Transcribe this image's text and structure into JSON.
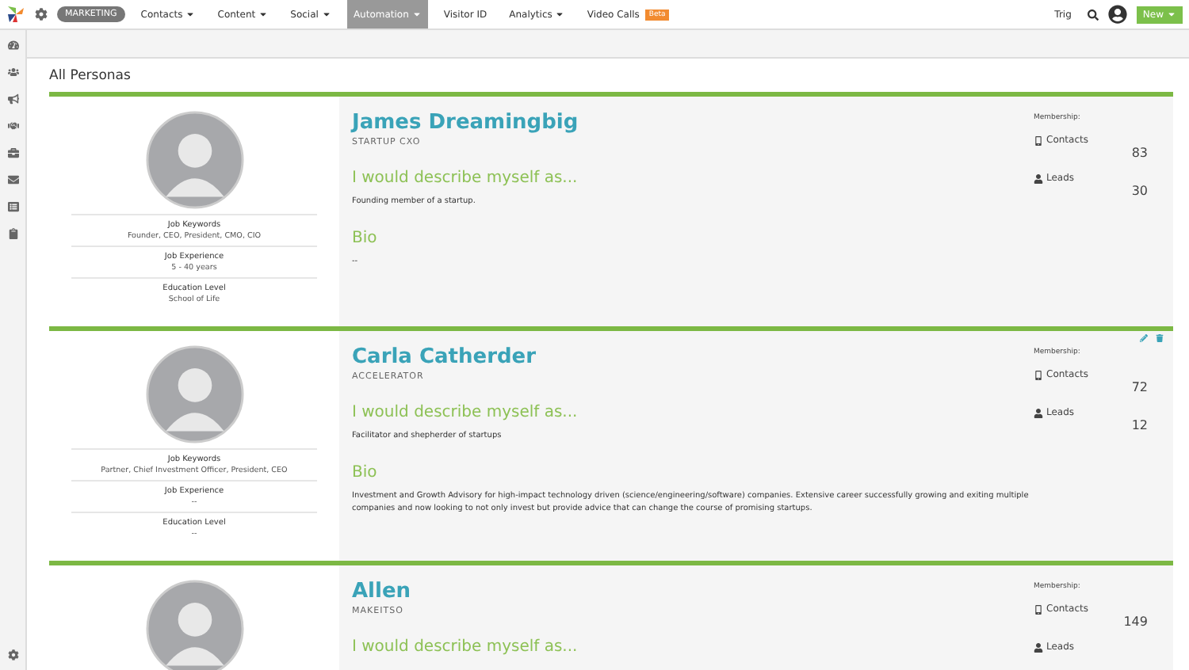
{
  "nav": {
    "badge": "MARKETING",
    "items": [
      {
        "label": "Contacts",
        "dropdown": true,
        "selected": false
      },
      {
        "label": "Content",
        "dropdown": true,
        "selected": false
      },
      {
        "label": "Social",
        "dropdown": true,
        "selected": false
      },
      {
        "label": "Automation",
        "dropdown": true,
        "selected": true
      },
      {
        "label": "Visitor ID",
        "dropdown": false,
        "selected": false
      },
      {
        "label": "Analytics",
        "dropdown": true,
        "selected": false
      },
      {
        "label": "Video Calls",
        "dropdown": false,
        "selected": false,
        "tag": "Beta"
      }
    ],
    "user": "Trig",
    "new_button": "New"
  },
  "page_title": "All Personas",
  "personas": [
    {
      "name": "James Dreamingbig",
      "role": "STARTUP CXO",
      "show_actions": false,
      "fields": [
        {
          "label": "Job Keywords",
          "value": "Founder, CEO, President, CMO, CIO"
        },
        {
          "label": "Job Experience",
          "value": "5 - 40 years"
        },
        {
          "label": "Education Level",
          "value": "School of Life"
        }
      ],
      "describe_heading": "I would describe myself as...",
      "describe": "Founding member of a startup.",
      "bio_heading": "Bio",
      "bio": "--",
      "membership_label": "Membership:",
      "contacts_label": "Contacts",
      "contacts": "83",
      "leads_label": "Leads",
      "leads": "30"
    },
    {
      "name": "Carla Catherder",
      "role": "ACCELERATOR",
      "show_actions": true,
      "fields": [
        {
          "label": "Job Keywords",
          "value": "Partner, Chief Investment Officer, President, CEO"
        },
        {
          "label": "Job Experience",
          "value": "--"
        },
        {
          "label": "Education Level",
          "value": "--"
        }
      ],
      "describe_heading": "I would describe myself as...",
      "describe": "Facilitator and shepherder of startups",
      "bio_heading": "Bio",
      "bio": "Investment and Growth Advisory for high-impact technology driven (science/engineering/software) companies. Extensive career successfully growing and exiting multiple companies and now looking to not only invest but provide advice that can change the course of promising startups.",
      "membership_label": "Membership:",
      "contacts_label": "Contacts",
      "contacts": "72",
      "leads_label": "Leads",
      "leads": "12"
    },
    {
      "name": "Allen",
      "role": "MAKEITSO",
      "show_actions": false,
      "describe_heading": "I would describe myself as...",
      "membership_label": "Membership:",
      "contacts_label": "Contacts",
      "contacts": "149",
      "leads_label": "Leads"
    }
  ]
}
